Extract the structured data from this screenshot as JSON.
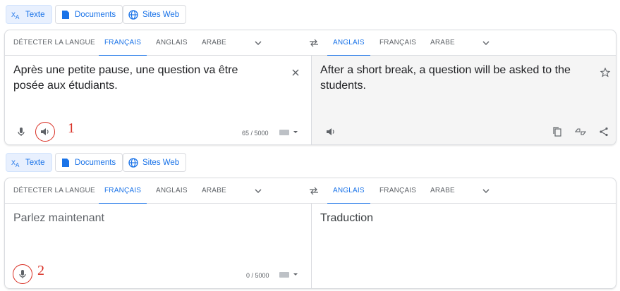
{
  "top": {
    "modes": [
      {
        "label": "Texte",
        "icon": "translate-icon",
        "active": true
      },
      {
        "label": "Documents",
        "icon": "document-icon",
        "active": false
      },
      {
        "label": "Sites Web",
        "icon": "globe-icon",
        "active": false
      }
    ],
    "source_langs": [
      "DÉTECTER LA LANGUE",
      "FRANÇAIS",
      "ANGLAIS",
      "ARABE"
    ],
    "target_langs": [
      "ANGLAIS",
      "FRANÇAIS",
      "ARABE"
    ],
    "source_text": "Après une petite pause, une question va être posée aux étudiants.",
    "target_text": "After a short break, a question will be asked to the students.",
    "counter": "65 / 5000",
    "annotation": "1"
  },
  "bottom": {
    "modes": [
      {
        "label": "Texte",
        "icon": "translate-icon",
        "active": true
      },
      {
        "label": "Documents",
        "icon": "document-icon",
        "active": false
      },
      {
        "label": "Sites Web",
        "icon": "globe-icon",
        "active": false
      }
    ],
    "source_langs": [
      "DÉTECTER LA LANGUE",
      "FRANÇAIS",
      "ANGLAIS",
      "ARABE"
    ],
    "target_langs": [
      "ANGLAIS",
      "FRANÇAIS",
      "ARABE"
    ],
    "source_placeholder": "Parlez maintenant",
    "target_placeholder": "Traduction",
    "counter": "0 / 5000",
    "annotation": "2"
  },
  "colors": {
    "accent": "#1a73e8",
    "annotation": "#d93025",
    "muted": "#5f6368"
  }
}
